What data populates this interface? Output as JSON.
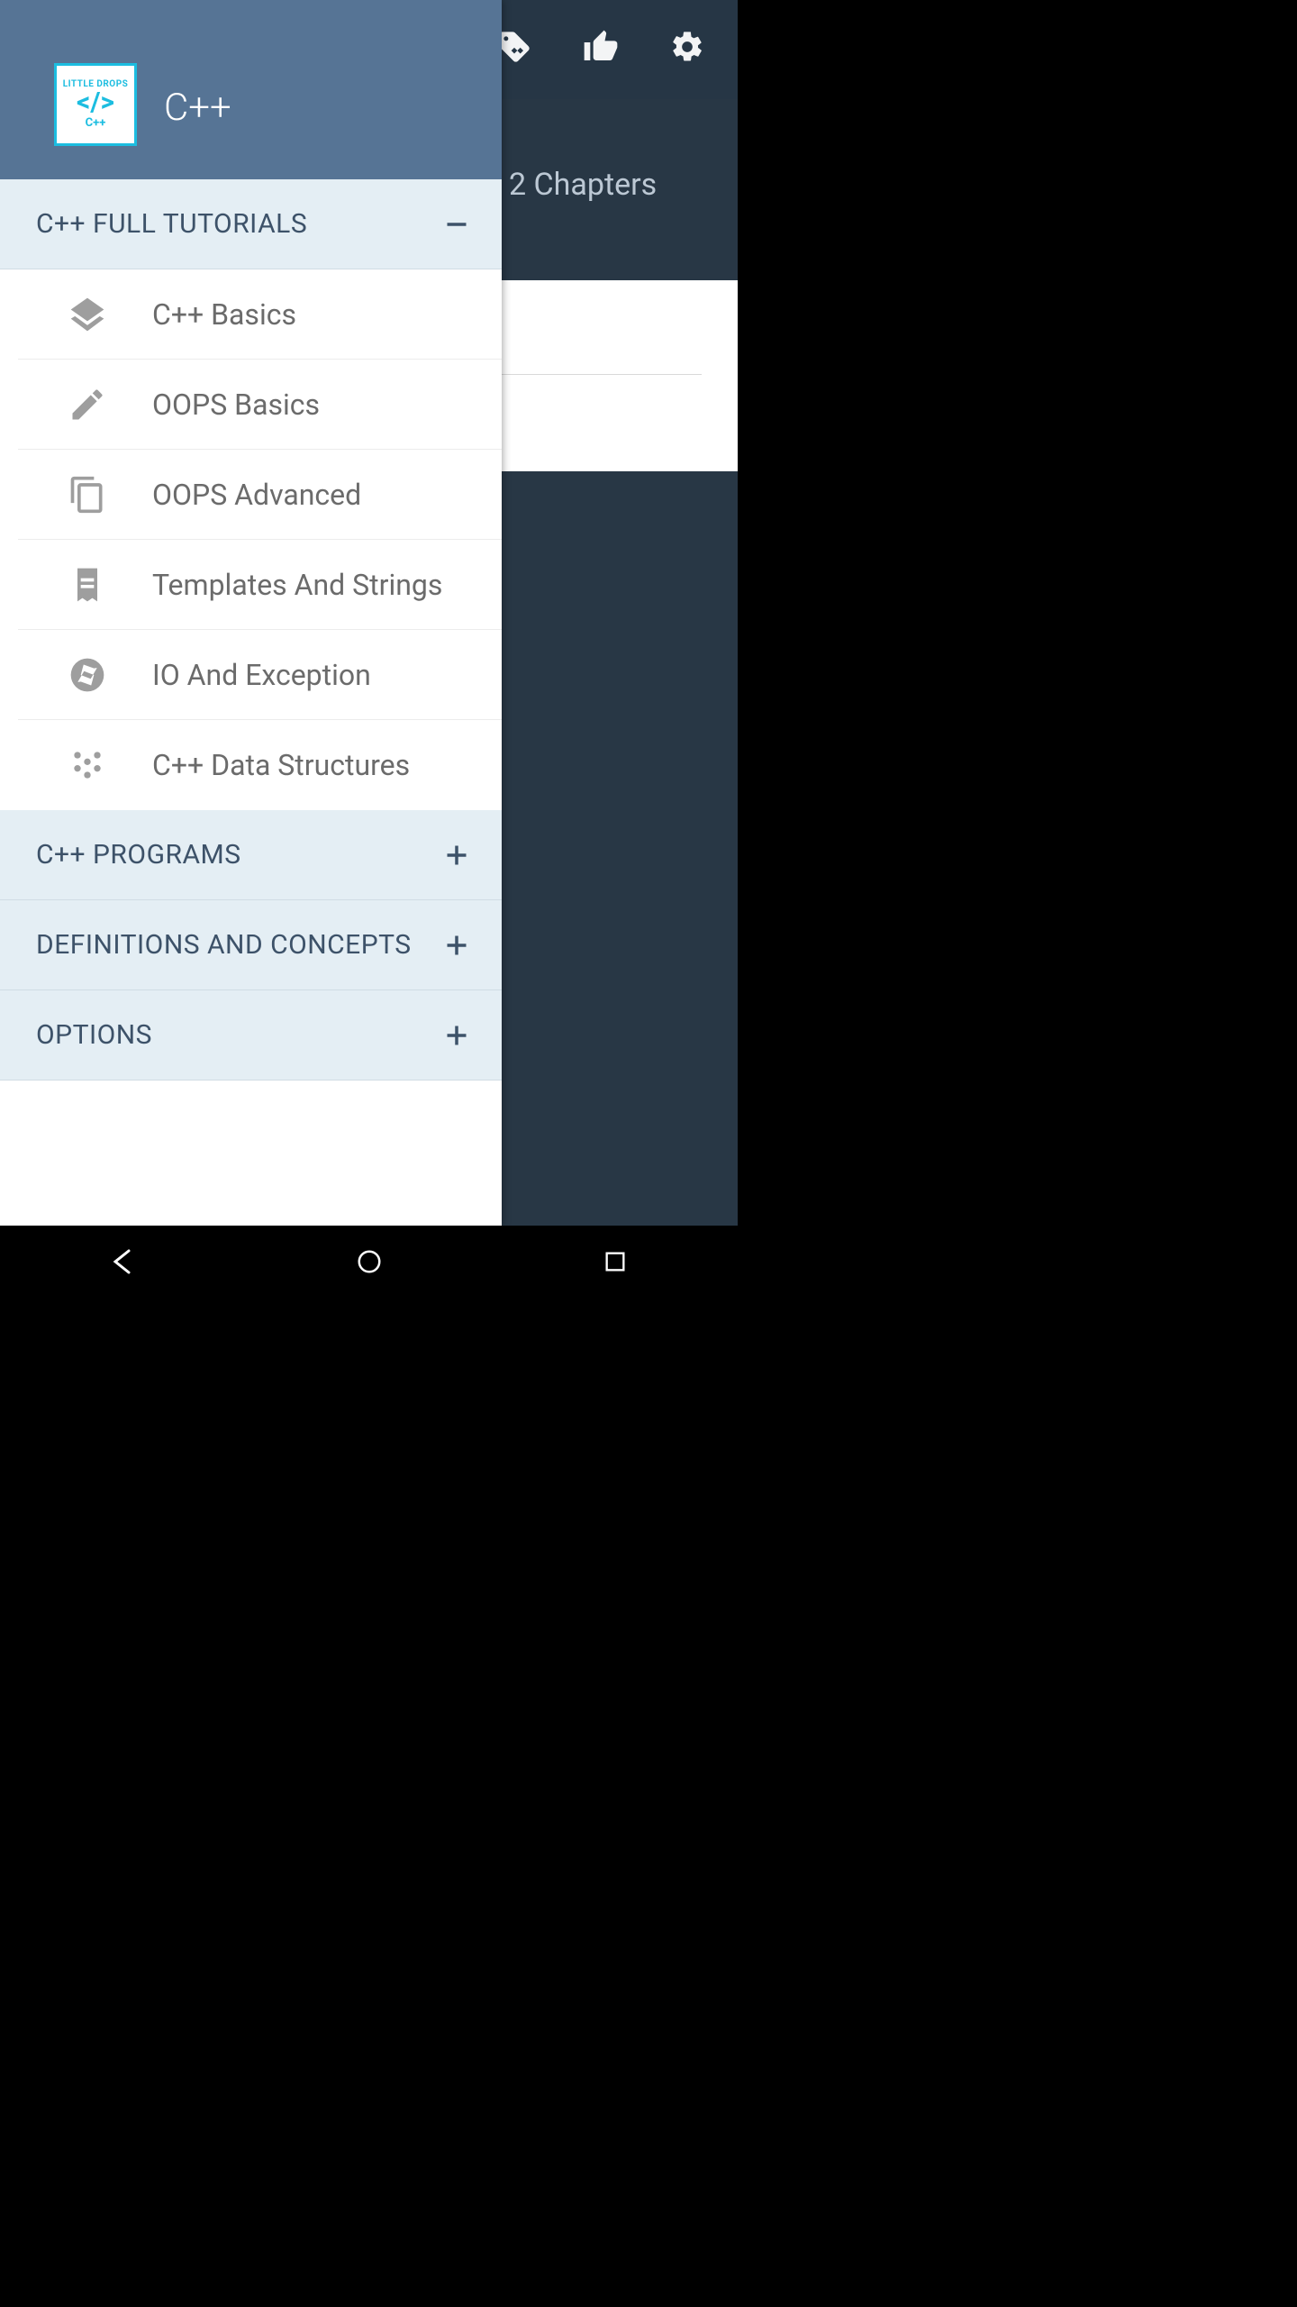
{
  "app": {
    "title": "C++",
    "logo_top": "LITTLE DROPS",
    "logo_bot": "C++"
  },
  "background": {
    "chapters_label": "2 Chapters"
  },
  "sections": {
    "tutorials": {
      "title": "C++ FULL TUTORIALS",
      "items": [
        {
          "label": "C++ Basics",
          "icon": "layers-icon"
        },
        {
          "label": "OOPS Basics",
          "icon": "pencil-icon"
        },
        {
          "label": "OOPS Advanced",
          "icon": "copy-icon"
        },
        {
          "label": "Templates And Strings",
          "icon": "receipt-icon"
        },
        {
          "label": "IO And Exception",
          "icon": "aperture-icon"
        },
        {
          "label": "C++ Data Structures",
          "icon": "grain-icon"
        }
      ]
    },
    "programs": {
      "title": "C++ PROGRAMS"
    },
    "definitions": {
      "title": "DEFINITIONS AND CONCEPTS"
    },
    "options": {
      "title": "OPTIONS"
    }
  }
}
